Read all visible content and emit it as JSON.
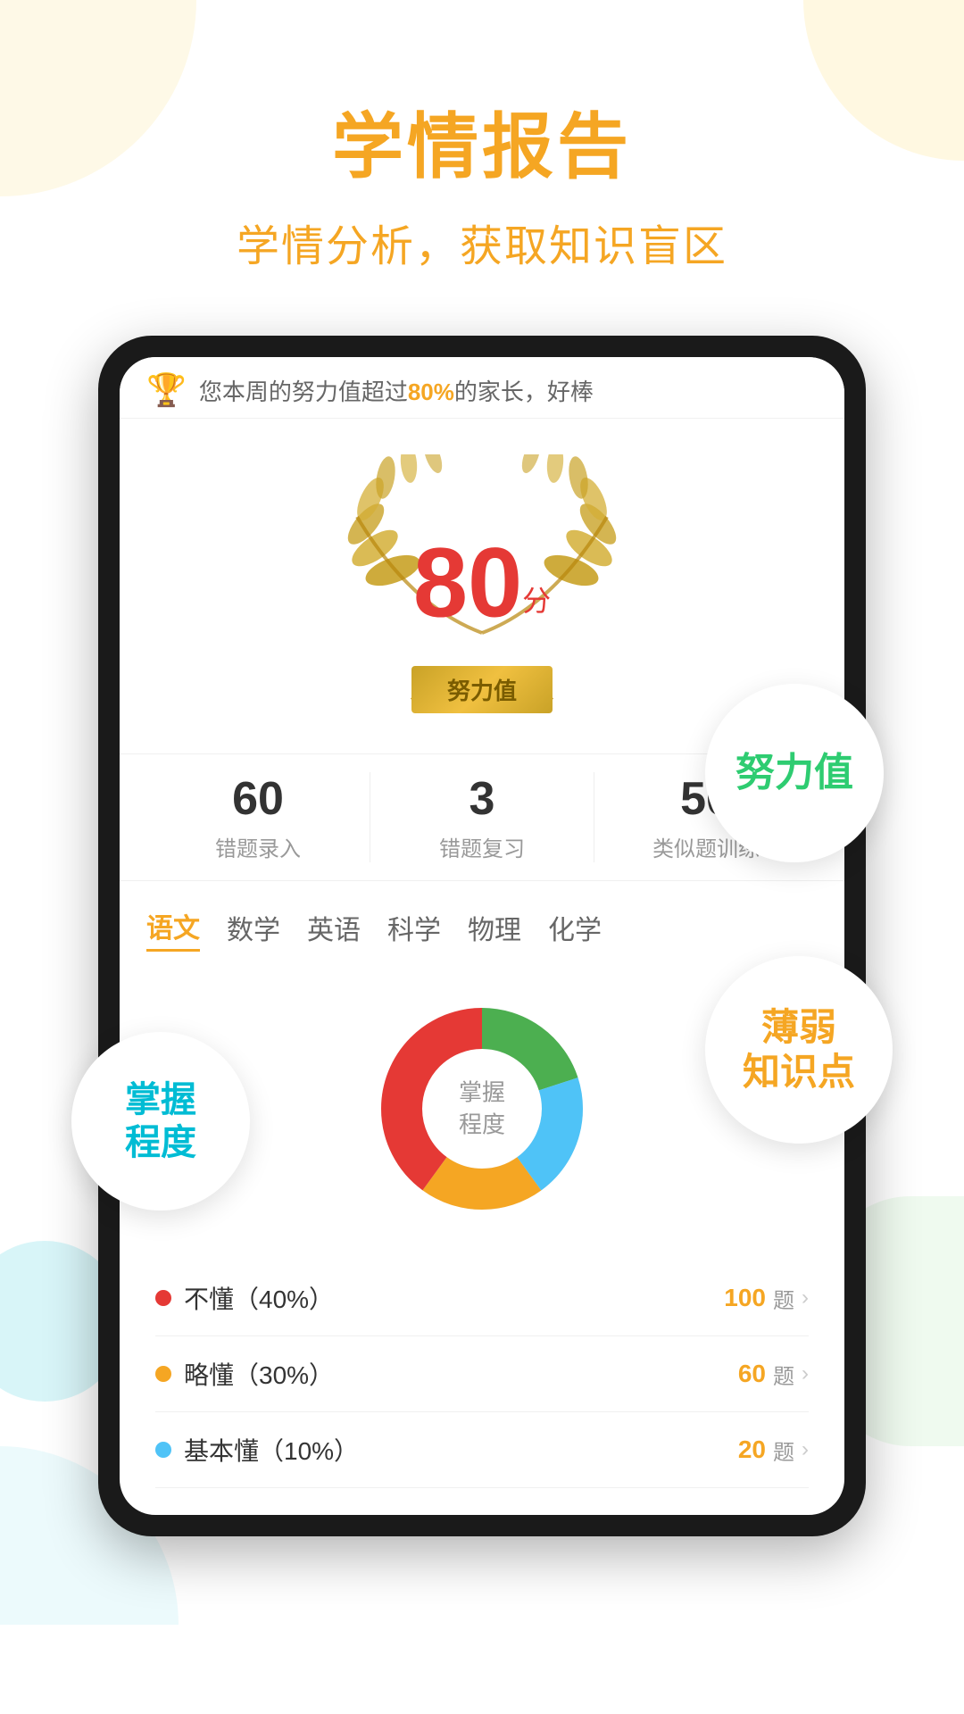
{
  "page": {
    "background_shapes": [
      "top-left-cream",
      "top-right-cream",
      "bottom-right-green",
      "bottom-left-cyan",
      "mid-left-cyan"
    ]
  },
  "header": {
    "main_title": "学情报告",
    "sub_title": "学情分析，获取知识盲区"
  },
  "phone": {
    "notification": {
      "text_prefix": "您本周的努力值超过",
      "highlight": "80%",
      "text_suffix": "的家长，好棒"
    },
    "score": {
      "value": "80",
      "unit": "分",
      "label": "努力值"
    },
    "stats": [
      {
        "number": "60",
        "label": "错题录入"
      },
      {
        "number": "3",
        "label": "错题复习"
      },
      {
        "number": "50",
        "label": "类似题训练"
      }
    ],
    "subject_tabs": [
      {
        "label": "语文",
        "active": true
      },
      {
        "label": "数学",
        "active": false
      },
      {
        "label": "英语",
        "active": false
      },
      {
        "label": "科学",
        "active": false
      },
      {
        "label": "物理",
        "active": false
      },
      {
        "label": "化学",
        "active": false
      }
    ],
    "chart": {
      "center_label": "掌握\n程度",
      "segments": [
        {
          "color": "#e53935",
          "percent": 40,
          "start": 0
        },
        {
          "color": "#f5a623",
          "percent": 20,
          "start": 40
        },
        {
          "color": "#4fc3f7",
          "percent": 20,
          "start": 60
        },
        {
          "color": "#4caf50",
          "percent": 20,
          "start": 80
        }
      ]
    },
    "legend": [
      {
        "dot_color": "#e53935",
        "label": "不懂（40%）",
        "count": "100",
        "unit": "题"
      },
      {
        "dot_color": "#f5a623",
        "label": "略懂（30%）",
        "count": "60",
        "unit": "题"
      },
      {
        "dot_color": "#4fc3f7",
        "label": "基本懂（10%）",
        "count": "20",
        "unit": "题"
      }
    ]
  },
  "badges": {
    "effort": {
      "text": "努力值",
      "color": "#2ecc71"
    },
    "mastery": {
      "text": "掌握\n程度",
      "color": "#00bcd4"
    },
    "weak_points": {
      "text": "薄弱\n知识点",
      "color": "#f5a623"
    }
  }
}
